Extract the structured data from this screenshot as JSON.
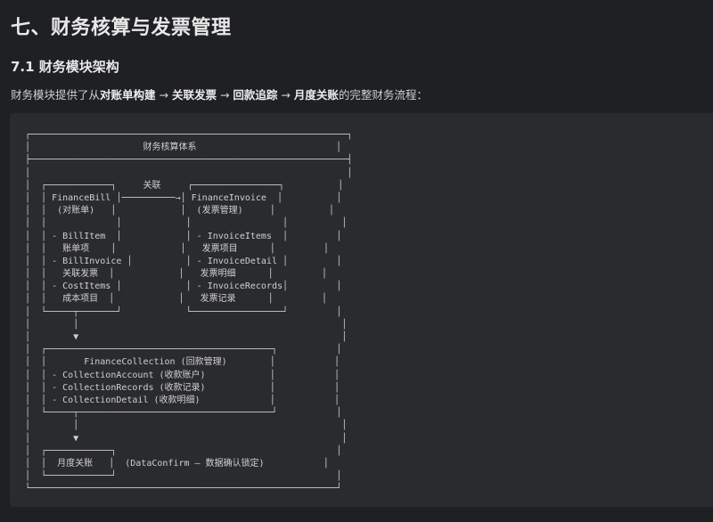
{
  "heading": "七、财务核算与发票管理",
  "subheading": "7.1 财务模块架构",
  "intro": {
    "prefix": "财务模块提供了从",
    "step1": "对账单构建",
    "arrow1": " → ",
    "step2": "关联发票",
    "arrow2": " → ",
    "step3": "回款追踪",
    "arrow3": " → ",
    "step4": "月度关账",
    "suffix": "的完整财务流程："
  },
  "diagram_lines": [
    "┌───────────────────────────────────────────────────────────┐",
    "│                     财务核算体系                          │",
    "├───────────────────────────────────────────────────────────┤",
    "│                                                           │",
    "│  ┌────────────┐     关联     ┌────────────────┐          │",
    "│  │ FinanceBill │──────────→│ FinanceInvoice  │          │",
    "│  │  (对账单)   │            │  (发票管理)     │          │",
    "│  │             │            │                 │          │",
    "│  │ - BillItem  │            │ - InvoiceItems  │         │",
    "│  │   账单项    │            │   发票项目      │         │",
    "│  │ - BillInvoice │          │ - InvoiceDetail │         │",
    "│  │   关联发票  │            │   发票明细      │         │",
    "│  │ - CostItems │            │ - InvoiceRecords│         │",
    "│  │   成本项目  │            │   发票记录      │         │",
    "│  └─────┬───────┘            └─────────────────┘         │",
    "│        │                                                 │",
    "│        ▼                                                 │",
    "│  ┌──────────────────────────────────────────┐           │",
    "│  │       FinanceCollection (回款管理)        │           │",
    "│  │ - CollectionAccount (收款账户)            │           │",
    "│  │ - CollectionRecords (收款记录)            │           │",
    "│  │ - CollectionDetail (收款明细)             │           │",
    "│  └─────┬────────────────────────────────────┘           │",
    "│        │                                                 │",
    "│        ▼                                                 │",
    "│  ┌────────────┐                                         │",
    "│  │  月度关账   │  (DataConfirm — 数据确认锁定)           │",
    "│  └────────────┘                                         │",
    "└─────────────────────────────────────────────────────────┘"
  ]
}
